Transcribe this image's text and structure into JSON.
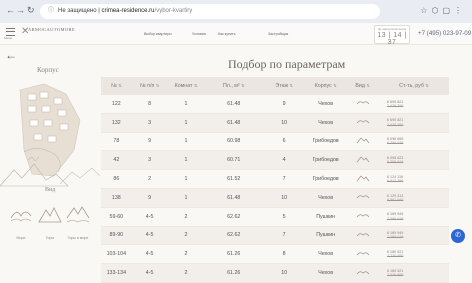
{
  "browser": {
    "security": "Не защищено",
    "host": "crimea-residence.ru",
    "path": "/vybor-kvartiry"
  },
  "site": {
    "logo_text": "ARMOCAUTOMORE",
    "logo_sub": "",
    "menu_label": "Меню",
    "nav": [
      "Выбор квартиры",
      "Условия",
      "Как купить",
      "Застройщик"
    ],
    "countdown_label": "До завершения акции",
    "countdown": [
      "13",
      "14",
      "37"
    ],
    "phone": "+7 (495) 023-97-09"
  },
  "page_title": "Подбор по параметрам",
  "filters": {
    "korpus_label": "Корпус",
    "vid_label": "Вид",
    "views": [
      "Море",
      "Горы",
      "Горы и море"
    ]
  },
  "table": {
    "headers": [
      "№",
      "№ п/п",
      "Комнат",
      "Пл., м²",
      "Этаж",
      "Корпус",
      "Вид",
      "Ст-ть, руб"
    ],
    "rows": [
      {
        "num": "122",
        "npp": "8",
        "rooms": "1",
        "area": "61.48",
        "floor": "9",
        "korpus": "Чехов",
        "view": "sea",
        "price": "6 690 821",
        "old": "7 470 350"
      },
      {
        "num": "132",
        "npp": "3",
        "rooms": "1",
        "area": "61.48",
        "floor": "10",
        "korpus": "Чехов",
        "view": "sea",
        "price": "6 690 821",
        "old": "7 470 350"
      },
      {
        "num": "78",
        "npp": "9",
        "rooms": "1",
        "area": "60.98",
        "floor": "6",
        "korpus": "Грибоедов",
        "view": "mountain",
        "price": "6 098 669",
        "old": "6 789 939"
      },
      {
        "num": "42",
        "npp": "3",
        "rooms": "1",
        "area": "60.71",
        "floor": "4",
        "korpus": "Грибоедов",
        "view": "mountain",
        "price": "6 098 623",
        "old": "6 709 918"
      },
      {
        "num": "86",
        "npp": "2",
        "rooms": "1",
        "area": "61.52",
        "floor": "7",
        "korpus": "Грибоедов",
        "view": "mountain",
        "price": "6 124 116",
        "old": "6 817 390"
      },
      {
        "num": "138",
        "npp": "9",
        "rooms": "1",
        "area": "61.48",
        "floor": "10",
        "korpus": "Чехов",
        "view": "sea",
        "price": "6 129 313",
        "old": "6 881 945"
      },
      {
        "num": "59-60",
        "npp": "4-5",
        "rooms": "2",
        "area": "62.62",
        "floor": "5",
        "korpus": "Пушкин",
        "view": "sea",
        "price": "6 169 949",
        "old": "7 290 019"
      },
      {
        "num": "89-90",
        "npp": "4-5",
        "rooms": "2",
        "area": "62.62",
        "floor": "7",
        "korpus": "Пушкин",
        "view": "sea",
        "price": "6 169 949",
        "old": "7 290 019"
      },
      {
        "num": "103-104",
        "npp": "4-5",
        "rooms": "2",
        "area": "61.26",
        "floor": "8",
        "korpus": "Чехов",
        "view": "sea",
        "price": "6 180 521",
        "old": "7 220 850"
      },
      {
        "num": "133-134",
        "npp": "4-5",
        "rooms": "2",
        "area": "61.26",
        "floor": "10",
        "korpus": "Чехов",
        "view": "sea",
        "price": "6 180 521",
        "old": "7 220 850"
      }
    ]
  },
  "colors": {
    "accent": "#2f66d6",
    "header_bg": "#ebe6df",
    "page_bg": "#faf8f5",
    "text": "#555555"
  }
}
